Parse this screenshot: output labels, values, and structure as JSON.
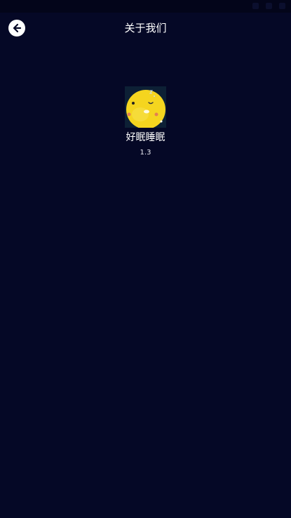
{
  "header": {
    "title": "关于我们",
    "back_icon": "back-arrow-icon"
  },
  "app": {
    "name": "好眠睡眠",
    "version": "1.3",
    "icon": "sleeping-moon-icon"
  },
  "colors": {
    "background": "#050826",
    "status_bar": "#03051a",
    "text": "#ffffff",
    "icon_yellow": "#f5d51f"
  }
}
